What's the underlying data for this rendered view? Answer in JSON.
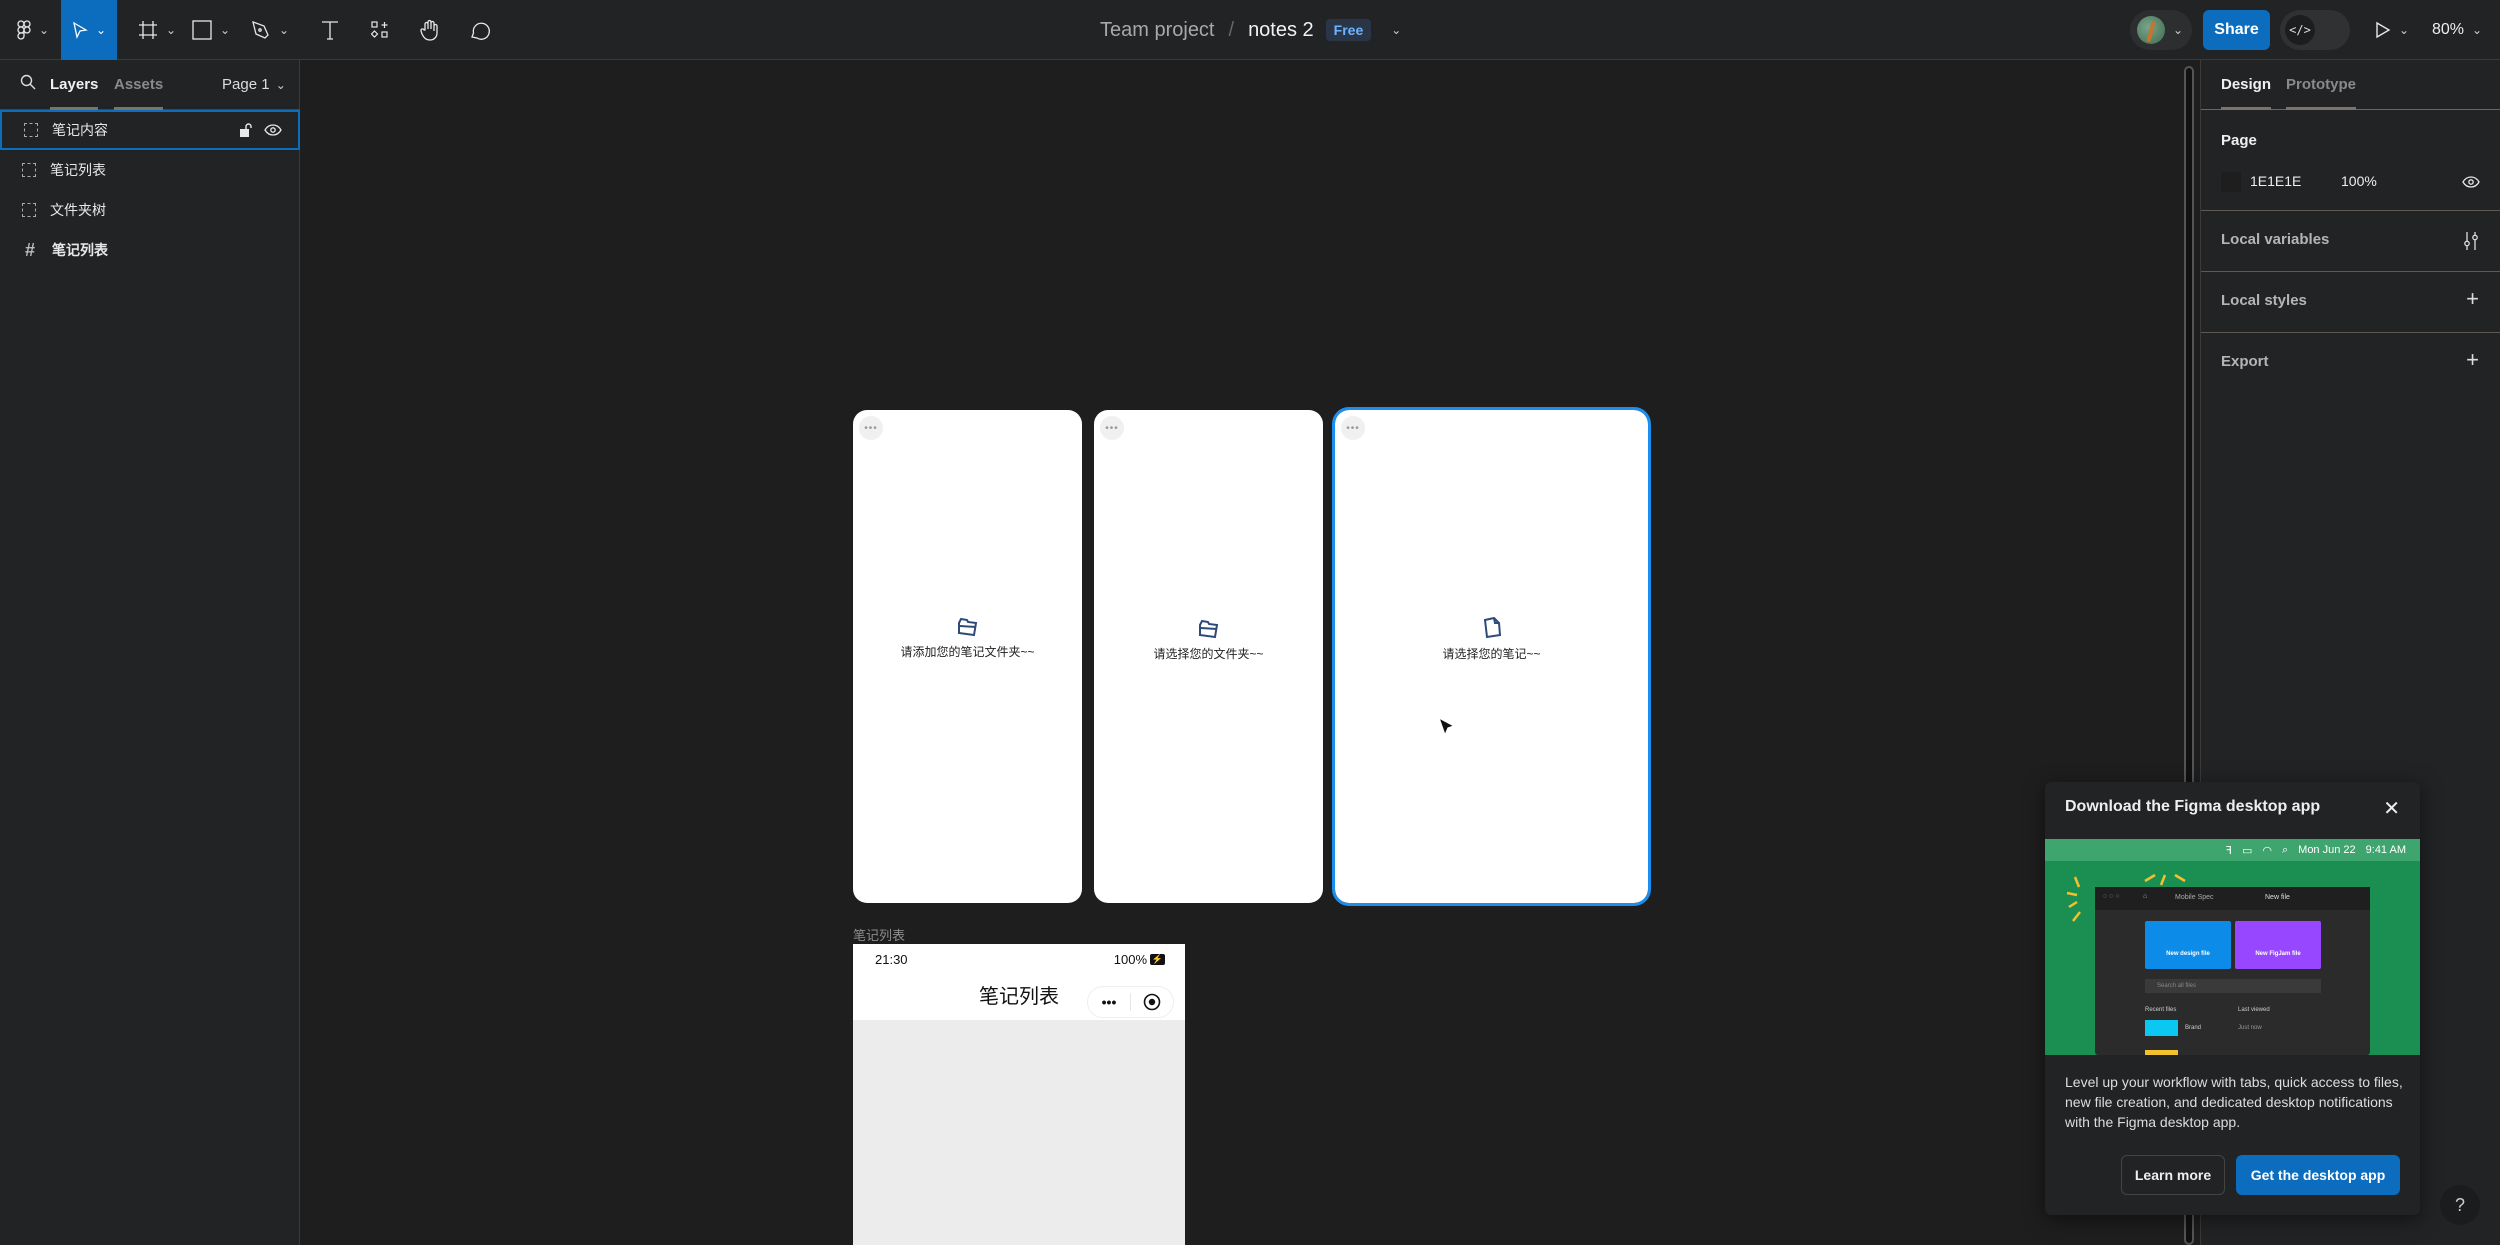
{
  "toolbar": {
    "tools": [
      "figma-menu",
      "move",
      "frame",
      "shape",
      "pen",
      "text",
      "resources",
      "hand",
      "comment"
    ],
    "breadcrumb_project": "Team project",
    "breadcrumb_sep": "/",
    "file_name": "notes 2",
    "plan_badge": "Free",
    "share_label": "Share",
    "dev_mode_icon": "</>",
    "zoom_level": "80%"
  },
  "left_panel": {
    "tabs": [
      {
        "label": "Layers",
        "selected": true
      },
      {
        "label": "Assets",
        "selected": false
      }
    ],
    "page_selector": "Page 1",
    "layers": [
      {
        "label": "笔记内容",
        "icon": "section-icon",
        "selected": true
      },
      {
        "label": "笔记列表",
        "icon": "section-icon",
        "selected": false
      },
      {
        "label": "文件夹树",
        "icon": "section-icon",
        "selected": false
      },
      {
        "label": "笔记列表",
        "icon": "frame-icon",
        "selected": false
      }
    ]
  },
  "canvas": {
    "frames": [
      {
        "empty_text": "请添加您的笔记文件夹~~",
        "icon": "folder-icon",
        "selected": false
      },
      {
        "empty_text": "请选择您的文件夹~~",
        "icon": "folder-icon",
        "selected": false
      },
      {
        "empty_text": "请选择您的笔记~~",
        "icon": "file-icon",
        "selected": true
      }
    ],
    "menu_dots": "•••",
    "phone_frame": {
      "label": "笔记列表",
      "status_time": "21:30",
      "status_battery": "100%",
      "nav_title": "笔记列表",
      "capsule_more": "•••"
    }
  },
  "right_panel": {
    "tabs": [
      {
        "label": "Design",
        "selected": true
      },
      {
        "label": "Prototype",
        "selected": false
      }
    ],
    "page_section": {
      "title": "Page",
      "color_hex": "1E1E1E",
      "opacity": "100%",
      "swatch_color": "#1E1E1E"
    },
    "sections": [
      {
        "title": "Local variables",
        "action": "variables-icon"
      },
      {
        "title": "Local styles",
        "action": "plus-icon"
      },
      {
        "title": "Export",
        "action": "plus-icon"
      }
    ]
  },
  "toast": {
    "title": "Download the Figma desktop app",
    "promo": {
      "menubar_date": "Mon Jun 22",
      "menubar_time": "9:41 AM",
      "tab_1": "Mobile Spec",
      "tab_2": "New file",
      "card_design": "New design file",
      "card_figjam": "New FigJam file",
      "search_placeholder": "Search all files",
      "col_recent": "Recent files",
      "col_last": "Last viewed",
      "row_name": "Brand",
      "row_time": "Just now"
    },
    "body": "Level up your workflow with tabs, quick access to files, new file creation, and dedicated desktop notifications with the Figma desktop app.",
    "learn_more": "Learn more",
    "get_app": "Get the desktop app"
  },
  "help_label": "?",
  "colors": {
    "accent": "#0C6CBD",
    "selection": "#1C8EF0",
    "promo_green": "#1B8F52"
  }
}
